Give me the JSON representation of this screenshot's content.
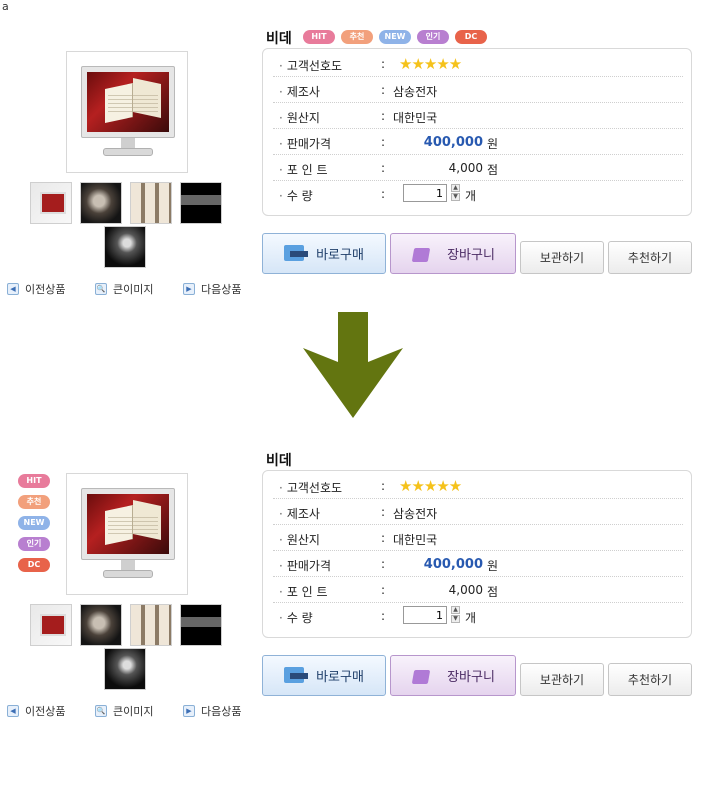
{
  "corner_label": "a",
  "product": {
    "title": "비데",
    "badges": {
      "hit": "HIT",
      "recommend": "추천",
      "new": "NEW",
      "popular": "인기",
      "dc": "DC"
    },
    "rating_label": "고객선호도",
    "rating_stars": "★★★★★",
    "maker_label": "제조사",
    "maker_value": "삼송전자",
    "origin_label": "원산지",
    "origin_value": "대한민국",
    "price_label": "판매가격",
    "price_value": "400,000",
    "price_unit": "원",
    "point_label": "포 인 트",
    "point_value": "4,000",
    "point_unit": "점",
    "qty_label": "수 량",
    "qty_value": "1",
    "qty_unit": "개",
    "colon": ":"
  },
  "nav": {
    "prev": "이전상품",
    "zoom": "큰이미지",
    "next": "다음상품"
  },
  "buttons": {
    "buy": "바로구매",
    "cart": "장바구니",
    "save": "보관하기",
    "recommend": "추천하기"
  },
  "colors": {
    "arrow": "#637510",
    "price": "#2859b0",
    "stars": "#f5c21b"
  }
}
